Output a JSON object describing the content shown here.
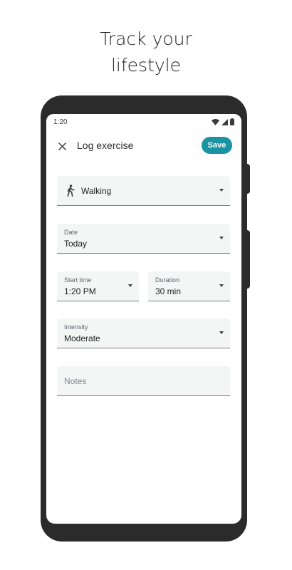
{
  "headline": {
    "line1": "Track your",
    "line2": "lifestyle"
  },
  "status_bar": {
    "time": "1:20"
  },
  "header": {
    "title": "Log exercise",
    "save_label": "Save"
  },
  "form": {
    "activity": {
      "value": "Walking",
      "icon": "walking-icon"
    },
    "date": {
      "label": "Date",
      "value": "Today"
    },
    "start_time": {
      "label": "Start time",
      "value": "1:20 PM"
    },
    "duration": {
      "label": "Duration",
      "value": "30 min"
    },
    "intensity": {
      "label": "Intensity",
      "value": "Moderate"
    },
    "notes": {
      "placeholder": "Notes"
    }
  },
  "colors": {
    "accent": "#1b93a2",
    "phone_frame": "#2b2b2b",
    "field_bg": "#f4f5f5"
  }
}
